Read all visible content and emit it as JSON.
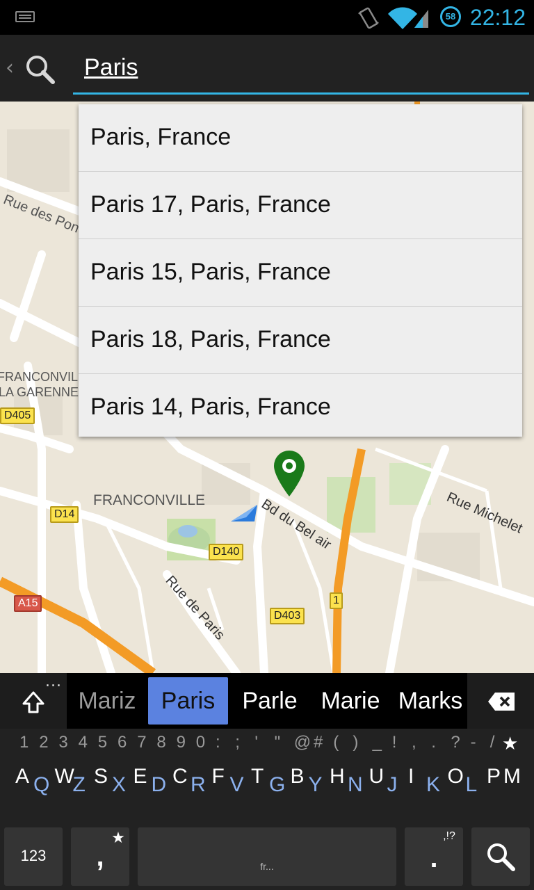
{
  "status_bar": {
    "time": "22:12",
    "battery": "58",
    "icons": [
      "keyboard-icon",
      "vibrate-icon",
      "wifi-icon",
      "signal-icon",
      "battery-icon"
    ],
    "accent_color": "#33b5e5"
  },
  "action_bar": {
    "search_query": "Paris",
    "icons": [
      "chevron-left-icon",
      "search-icon"
    ]
  },
  "suggestions": [
    "Paris, France",
    "Paris 17, Paris, France",
    "Paris 15, Paris, France",
    "Paris 18, Paris, France",
    "Paris 14, Paris, France"
  ],
  "map": {
    "labels": {
      "rue_des_pon": "Rue des Pon",
      "franconville_la_garenne_1": "FRANCONVILLE",
      "franconville_la_garenne_2": "LA GARENNE",
      "franconville": "FRANCONVILLE",
      "bd_du_bel_air": "Bd du Bel air",
      "rue_michelet": "Rue Michelet",
      "rue_de_paris": "Rue de Paris"
    },
    "road_badges": {
      "d405": "D405",
      "d14": "D14",
      "d140": "D140",
      "d403": "D403",
      "a15": "A15",
      "r1": "1"
    },
    "marker_color": "#1a7a1a",
    "arrow_color": "#2b7bdc"
  },
  "keyboard": {
    "suggestion_words": [
      "Mariz",
      "Paris",
      "Parle",
      "Marie",
      "Marks"
    ],
    "selected_word": "Paris",
    "more_dots": "...",
    "number_row": [
      "1",
      "2",
      "3",
      "4",
      "5",
      "6",
      "7",
      "8",
      "9",
      "0",
      ":",
      ";",
      "'",
      "\"",
      "@",
      "#",
      "(",
      ")",
      "_",
      "!",
      ",",
      ".",
      "?",
      "-",
      "/",
      "★"
    ],
    "letter_pairs": [
      [
        "A",
        "Q"
      ],
      [
        "W",
        "Z"
      ],
      [
        "S",
        "X"
      ],
      [
        "E",
        "D"
      ],
      [
        "C",
        "R"
      ],
      [
        "F",
        "V"
      ],
      [
        "T",
        "G"
      ],
      [
        "B",
        "Y"
      ],
      [
        "H",
        "N"
      ],
      [
        "U",
        "J"
      ],
      [
        "I",
        "K"
      ],
      [
        "O",
        "L"
      ],
      [
        "P",
        "M"
      ]
    ],
    "key_123": "123",
    "key_comma": ",",
    "key_comma_star": "★",
    "key_space_hint": "fr...",
    "key_period": ".",
    "key_period_hint": ",!?",
    "accent_lower": "#8cb1ee",
    "selected_color": "#5b82e0"
  }
}
